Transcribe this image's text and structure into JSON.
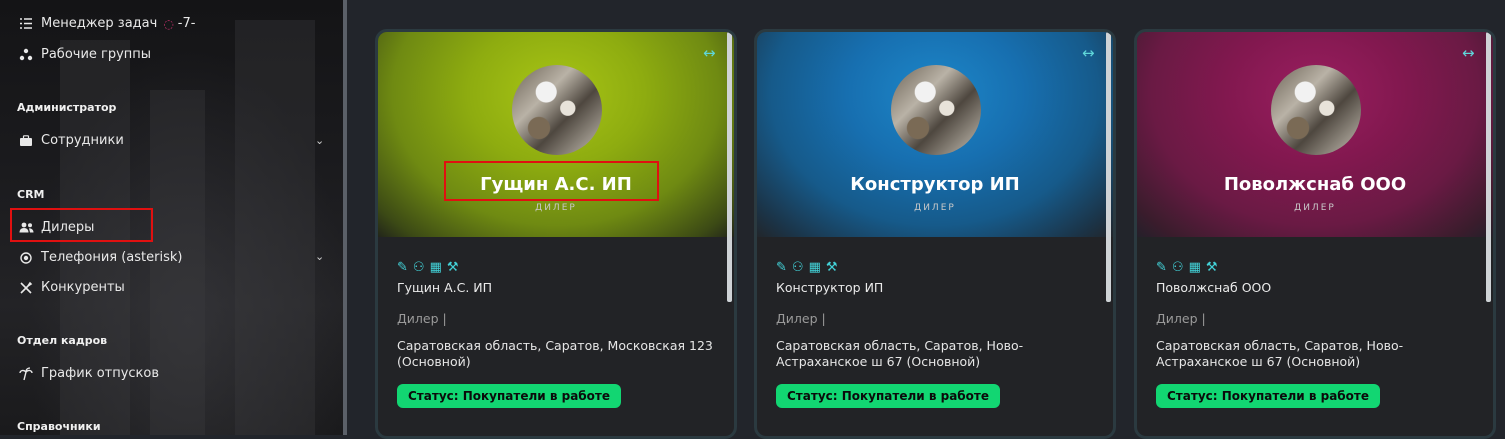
{
  "sidebar": {
    "task_manager": {
      "label": "Менеджер задач",
      "badge": "-7-"
    },
    "work_groups": {
      "label": "Рабочие группы"
    },
    "sections": {
      "admin": "Администратор",
      "crm": "CRM",
      "hr": "Отдел кадров",
      "refs": "Справочники"
    },
    "employees": {
      "label": "Сотрудники"
    },
    "dealers": {
      "label": "Дилеры"
    },
    "telephony": {
      "label": "Телефония (asterisk)"
    },
    "competitors": {
      "label": "Конкуренты"
    },
    "vacation": {
      "label": "График отпусков"
    }
  },
  "cards": [
    {
      "title": "Гущин А.С. ИП",
      "subtitle": "ДИЛЕР",
      "name": "Гущин А.С. ИП",
      "role": "Дилер |",
      "address": "Саратовская область, Саратов, Московская 123 (Основной)",
      "status": "Статус: Покупатели в работе",
      "banner_color": "#8fb30e"
    },
    {
      "title": "Конструктор ИП",
      "subtitle": "ДИЛЕР",
      "name": "Конструктор ИП",
      "role": "Дилер |",
      "address": "Саратовская область, Саратов, Ново-Астраханское ш 67 (Основной)",
      "status": "Статус: Покупатели в работе",
      "banner_color": "#1a79b8"
    },
    {
      "title": "Поволжснаб ООО",
      "subtitle": "ДИЛЕР",
      "name": "Поволжснаб ООО",
      "role": "Дилер |",
      "address": "Саратовская область, Саратов, Ново-Астраханское ш 67 (Основной)",
      "status": "Статус: Покупатели в работе",
      "banner_color": "#8a1b56"
    }
  ],
  "colors": {
    "accent": "#43d2d8",
    "status_bg": "#12d672",
    "highlight": "#e01010"
  },
  "icons": [
    "list-check-icon",
    "sitemap-icon",
    "briefcase-icon",
    "users-icon",
    "phone-icon",
    "tools-icon",
    "palm-icon",
    "pencil-icon",
    "user-gear-icon",
    "calendar-icon",
    "expand-icon",
    "chevron-down-icon"
  ]
}
